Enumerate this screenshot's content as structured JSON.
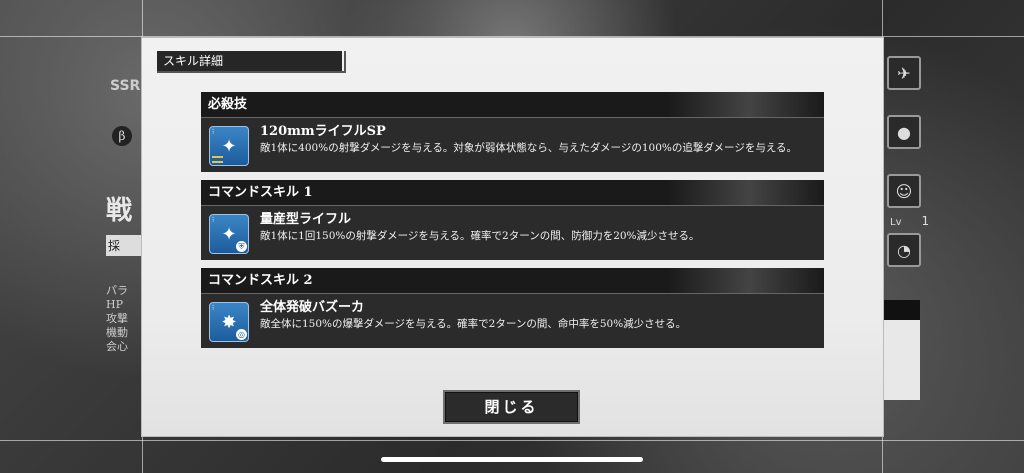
{
  "background": {
    "ssr_label": "SSR",
    "beta_label": "β",
    "title_char": "戦",
    "box_label": "採",
    "stat_lines": [
      "パラ",
      "HP",
      "攻撃",
      "機動",
      "会心"
    ],
    "level_label": "Lv",
    "level_value": "1"
  },
  "modal": {
    "title": "スキル詳細",
    "skills": [
      {
        "category": "必殺技",
        "name": "120mmライフルSP",
        "description": "敵1体に400%の射撃ダメージを与える。対象が弱体状態なら、与えたダメージの100%の追撃ダメージを与える。",
        "icon": "rifle-icon"
      },
      {
        "category": "コマンドスキル 1",
        "name": "量産型ライフル",
        "description": "敵1体に1回150%の射撃ダメージを与える。確率で2ターンの間、防御力を20%減少させる。",
        "icon": "rifle-icon"
      },
      {
        "category": "コマンドスキル 2",
        "name": "全体発破バズーカ",
        "description": "敵全体に150%の爆撃ダメージを与える。確率で2ターンの間、命中率を50%減少させる。",
        "icon": "bomb-icon"
      }
    ],
    "close_label": "閉じる"
  }
}
